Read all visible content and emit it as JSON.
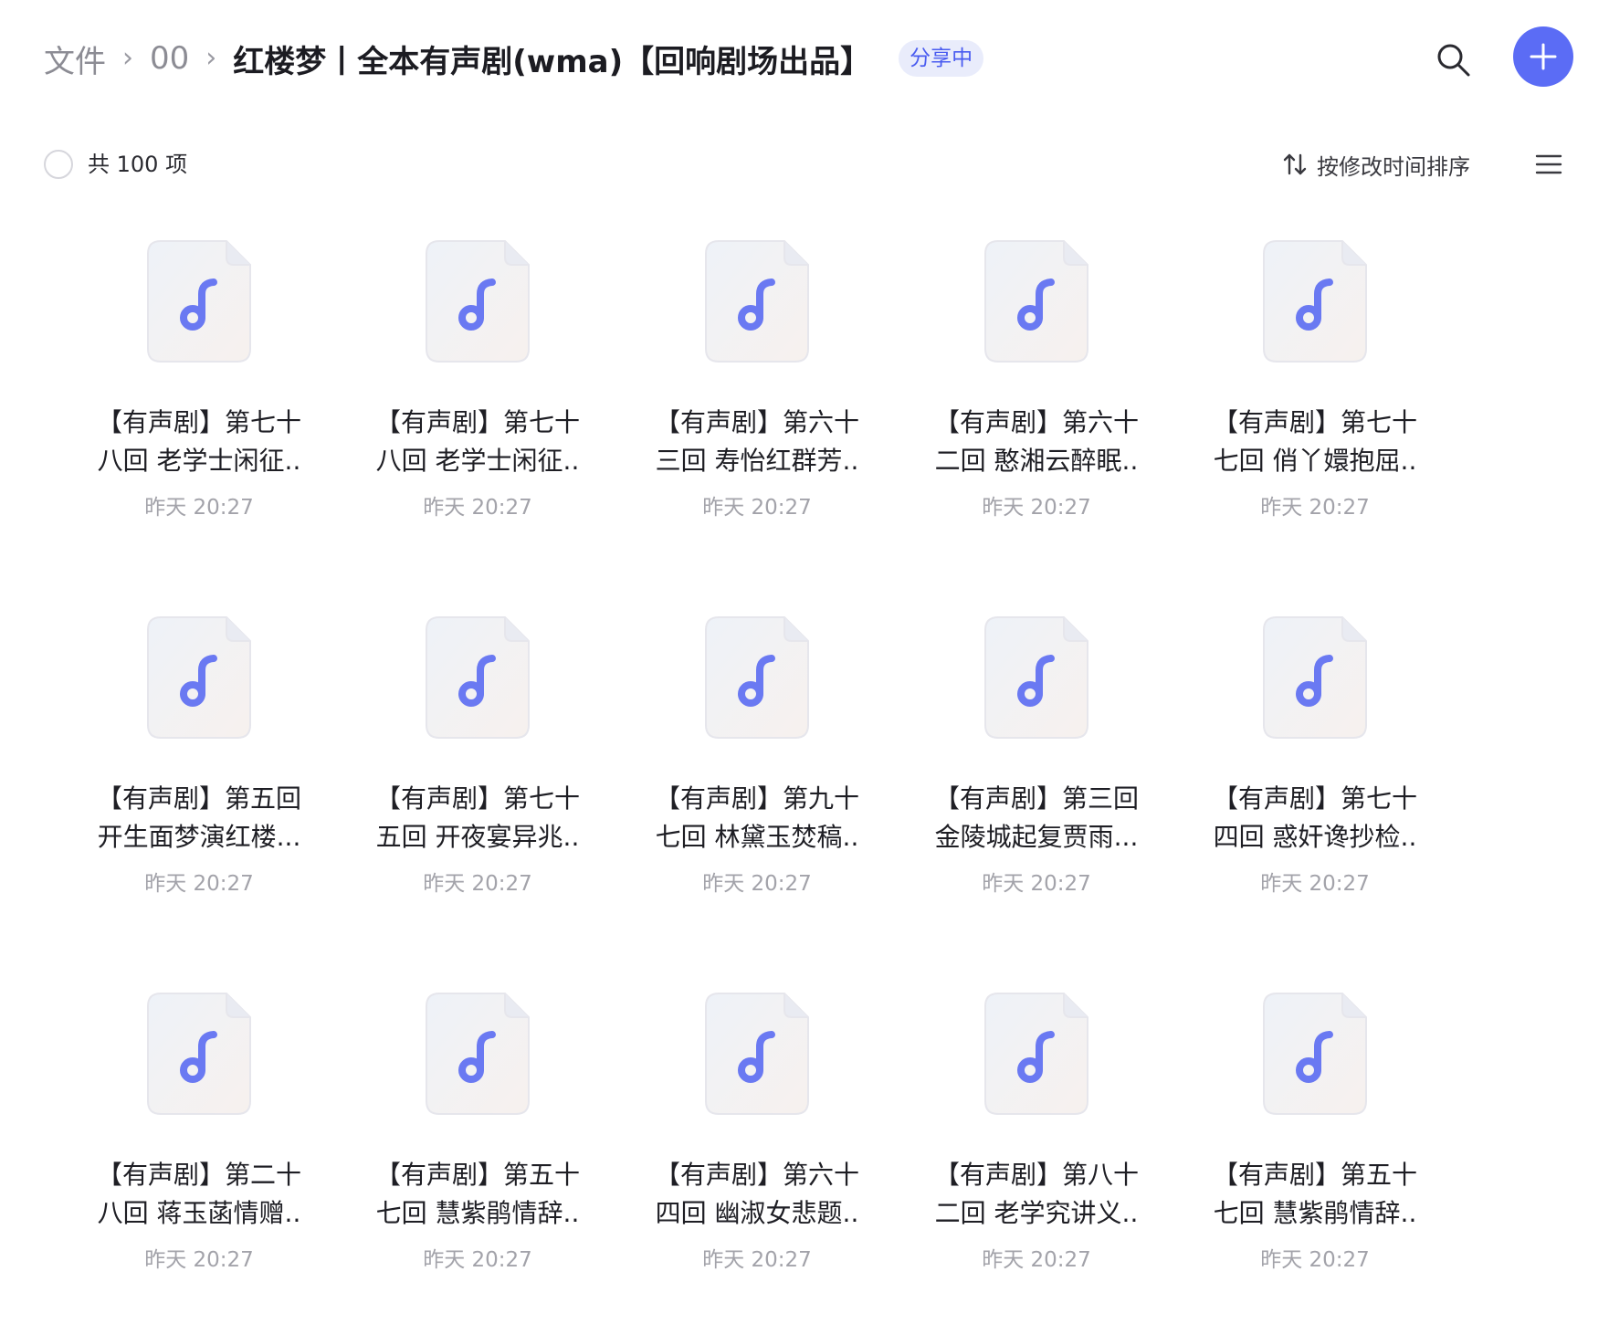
{
  "breadcrumb": {
    "root": "文件",
    "parent": "00",
    "current": "红楼梦丨全本有声剧(wma)【回响剧场出品】",
    "share_badge": "分享中"
  },
  "toolbar": {
    "count_label": "共 100 项",
    "sort_label": "按修改时间排序"
  },
  "icons": {
    "search": "search-icon",
    "add": "plus-icon",
    "sort": "sort-arrows-icon",
    "view": "list-view-icon",
    "file": "music-note-icon"
  },
  "colors": {
    "accent": "#5b6cf5",
    "badge_bg": "#e9ecfb",
    "badge_text": "#4a5cf0",
    "note": "#6a79f2"
  },
  "files": [
    {
      "line1": "【有声剧】第七十",
      "line2": "八回 老学士闲征..",
      "time": "昨天 20:27"
    },
    {
      "line1": "【有声剧】第七十",
      "line2": "八回 老学士闲征..",
      "time": "昨天 20:27"
    },
    {
      "line1": "【有声剧】第六十",
      "line2": "三回 寿怡红群芳..",
      "time": "昨天 20:27"
    },
    {
      "line1": "【有声剧】第六十",
      "line2": "二回 憨湘云醉眠..",
      "time": "昨天 20:27"
    },
    {
      "line1": "【有声剧】第七十",
      "line2": "七回 俏丫嬛抱屈..",
      "time": "昨天 20:27"
    },
    {
      "line1": "【有声剧】第五回",
      "line2": "开生面梦演红楼...",
      "time": "昨天 20:27"
    },
    {
      "line1": "【有声剧】第七十",
      "line2": "五回 开夜宴异兆..",
      "time": "昨天 20:27"
    },
    {
      "line1": "【有声剧】第九十",
      "line2": "七回 林黛玉焚稿..",
      "time": "昨天 20:27"
    },
    {
      "line1": "【有声剧】第三回",
      "line2": "金陵城起复贾雨...",
      "time": "昨天 20:27"
    },
    {
      "line1": "【有声剧】第七十",
      "line2": "四回 惑奸谗抄检..",
      "time": "昨天 20:27"
    },
    {
      "line1": "【有声剧】第二十",
      "line2": "八回 蒋玉菡情赠..",
      "time": "昨天 20:27"
    },
    {
      "line1": "【有声剧】第五十",
      "line2": "七回 慧紫鹃情辞..",
      "time": "昨天 20:27"
    },
    {
      "line1": "【有声剧】第六十",
      "line2": "四回 幽淑女悲题..",
      "time": "昨天 20:27"
    },
    {
      "line1": "【有声剧】第八十",
      "line2": "二回 老学究讲义..",
      "time": "昨天 20:27"
    },
    {
      "line1": "【有声剧】第五十",
      "line2": "七回 慧紫鹃情辞..",
      "time": "昨天 20:27"
    }
  ]
}
